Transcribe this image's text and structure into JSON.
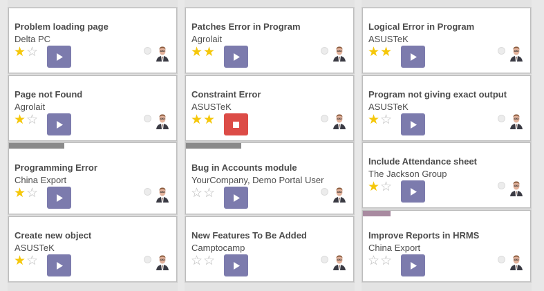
{
  "colors": {
    "play_button": "#7c7bad",
    "stop_button": "#dc4c47",
    "star_on": "#f5c70a",
    "star_off": "#b8b8b8",
    "tag_gray": "#8a8a8a",
    "tag_mauve": "#a88aa0"
  },
  "columns": [
    {
      "cards": [
        {
          "title": "Problem loading page",
          "customer": "Delta PC",
          "stars": 1,
          "state": "play",
          "icon": "play-icon"
        },
        {
          "title": "Page not Found",
          "customer": "Agrolait",
          "stars": 1,
          "state": "play",
          "icon": "play-icon"
        },
        {
          "title": "Programming Error",
          "customer": "China Export",
          "stars": 1,
          "state": "play",
          "icon": "play-icon",
          "tag": "gray"
        },
        {
          "title": "Create new object",
          "customer": "ASUSTeK",
          "stars": 1,
          "state": "play",
          "icon": "play-icon"
        }
      ]
    },
    {
      "cards": [
        {
          "title": "Patches Error in Program",
          "customer": "Agrolait",
          "stars": 2,
          "state": "play",
          "icon": "play-icon"
        },
        {
          "title": "Constraint Error",
          "customer": "ASUSTeK",
          "stars": 2,
          "state": "stop",
          "icon": "stop-icon"
        },
        {
          "title": "Bug in Accounts module",
          "customer": "YourCompany, Demo Portal User",
          "stars": 0,
          "state": "play",
          "icon": "play-icon",
          "tag": "gray"
        },
        {
          "title": "New Features To Be Added",
          "customer": "Camptocamp",
          "stars": 0,
          "state": "play",
          "icon": "play-icon"
        }
      ]
    },
    {
      "cards": [
        {
          "title": "Logical Error in Program",
          "customer": "ASUSTeK",
          "stars": 2,
          "state": "play",
          "icon": "play-icon"
        },
        {
          "title": "Program not giving exact output",
          "customer": "ASUSTeK",
          "stars": 1,
          "state": "play",
          "icon": "play-icon"
        },
        {
          "title": "Include Attendance sheet",
          "customer": "The Jackson Group",
          "stars": 1,
          "state": "play",
          "icon": "play-icon"
        },
        {
          "title": "Improve Reports in HRMS",
          "customer": "China Export",
          "stars": 0,
          "state": "play",
          "icon": "play-icon",
          "tag": "mauve"
        }
      ]
    }
  ]
}
